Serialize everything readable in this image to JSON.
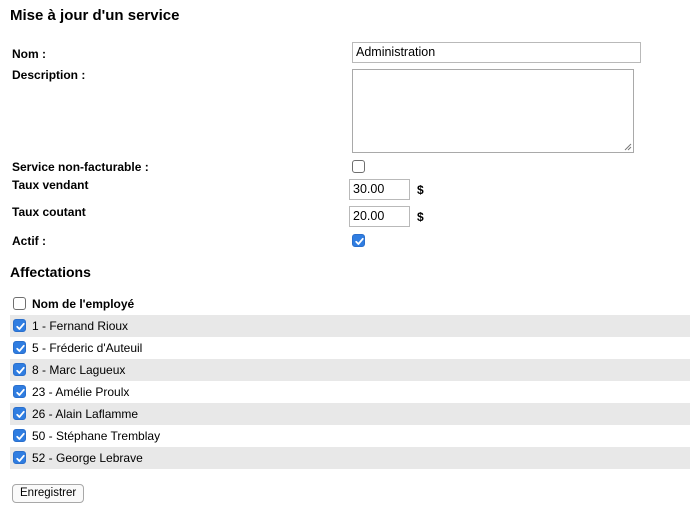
{
  "page": {
    "title": "Mise à jour d'un service"
  },
  "form": {
    "name_label": "Nom :",
    "name_value": "Administration",
    "description_label": "Description :",
    "description_value": "",
    "non_billable_label": "Service non-facturable :",
    "non_billable_checked": false,
    "sell_rate_label": "Taux vendant",
    "sell_rate_value": "30.00",
    "cost_rate_label": "Taux coutant",
    "cost_rate_value": "20.00",
    "currency": "$",
    "active_label": "Actif :",
    "active_checked": true
  },
  "assignments": {
    "title": "Affectations",
    "header_label": "Nom de l'employé",
    "header_checked": false,
    "employees": [
      {
        "label": "1 - Fernand Rioux",
        "checked": true
      },
      {
        "label": "5 - Fréderic d'Auteuil",
        "checked": true
      },
      {
        "label": "8 - Marc Lagueux",
        "checked": true
      },
      {
        "label": "23 - Amélie Proulx",
        "checked": true
      },
      {
        "label": "26 - Alain Laflamme",
        "checked": true
      },
      {
        "label": "50 - Stéphane Tremblay",
        "checked": true
      },
      {
        "label": "52 - George Lebrave",
        "checked": true
      }
    ]
  },
  "actions": {
    "save_label": "Enregistrer"
  },
  "colors": {
    "checkbox_checked": "#2f7de1",
    "row_shade": "#e8e8e8"
  }
}
